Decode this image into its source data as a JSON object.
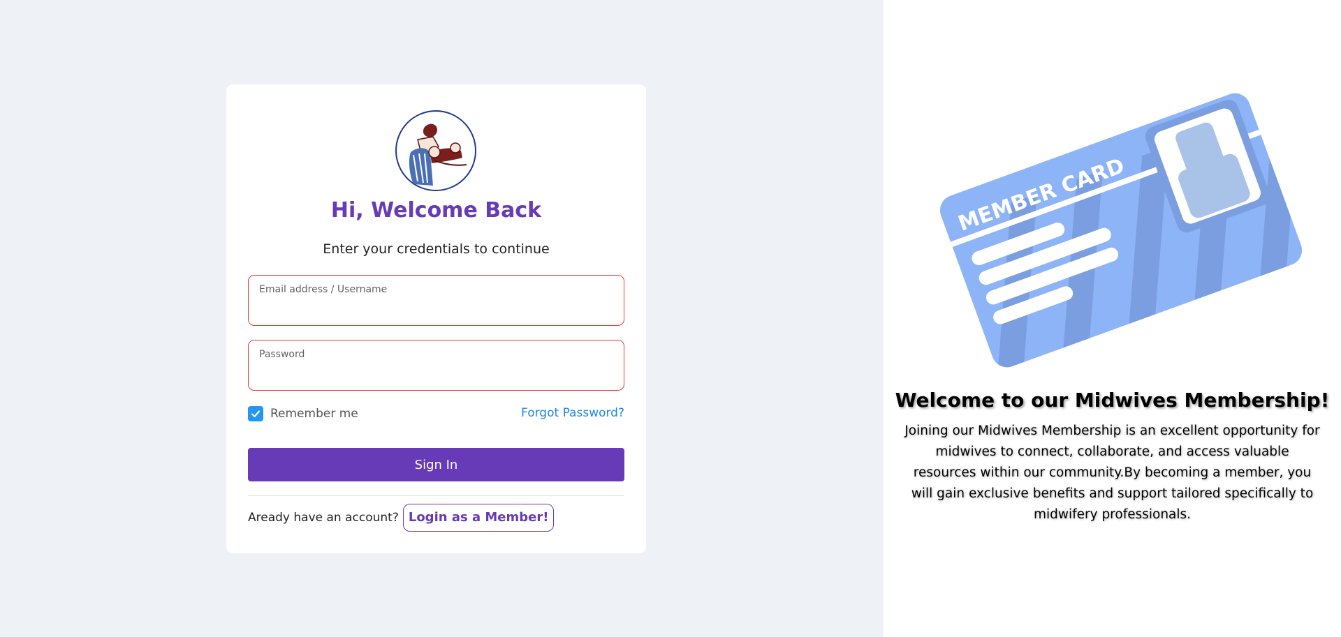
{
  "login_card": {
    "title": "Hi, Welcome Back",
    "subtitle": "Enter your credentials to continue",
    "email_label": "Email address / Username",
    "password_label": "Password",
    "remember_label": "Remember me",
    "remember_checked": true,
    "forgot_label": "Forgot Password?",
    "signin_label": "Sign In",
    "bottom_text": "Aready have an account?",
    "member_login_label": "Login as a Member!"
  },
  "promo": {
    "card_text": "MEMBER CARD",
    "title": "Welcome to our Midwives Membership!",
    "text": "Joining our Midwives Membership is an excellent opportunity for midwives to connect, collaborate, and access valuable resources within our community.By becoming a member, you will gain exclusive benefits and support tailored specifically to midwifery professionals."
  },
  "colors": {
    "accent": "#673ab7",
    "link": "#1e88e5",
    "error_border": "#e53935",
    "checkbox": "#2196f3",
    "left_background": "#eef2f6"
  },
  "icons": {
    "logo": "midwife-logo-icon",
    "checkbox": "check-icon",
    "illustration": "member-card-illustration"
  }
}
